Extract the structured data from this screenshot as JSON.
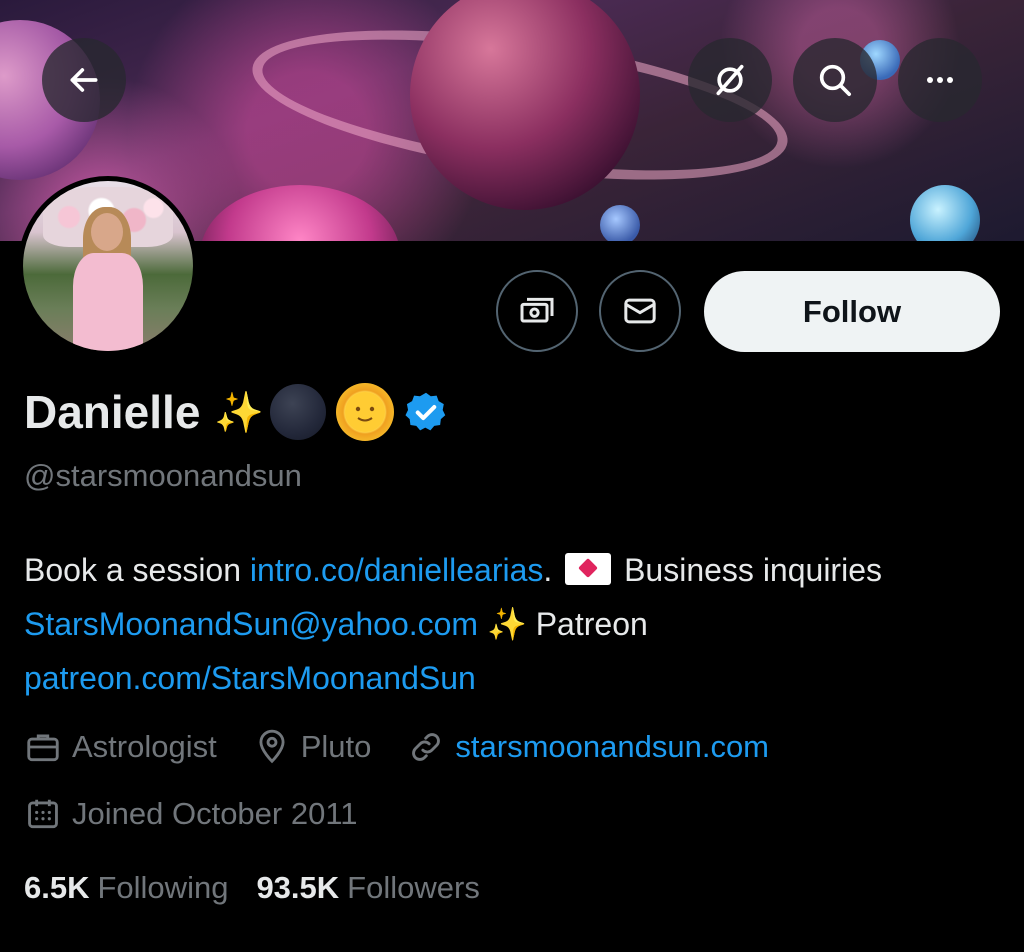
{
  "header": {
    "back_icon": "arrow-left-icon",
    "grok_icon": "grok-icon",
    "search_icon": "search-icon",
    "more_icon": "more-horizontal-icon"
  },
  "actions": {
    "subscribe_icon": "money-icon",
    "message_icon": "mail-icon",
    "follow_label": "Follow"
  },
  "profile": {
    "display_name": "Danielle",
    "name_emoji_sparkles": "✨",
    "handle": "@starsmoonandsun",
    "verified_color": "#1d9bf0"
  },
  "bio": {
    "t1": "Book a session ",
    "link1": "intro.co/daniellearias",
    "t2": ". ",
    "t3": " Business inquiries ",
    "link2": "StarsMoonandSun@yahoo.com",
    "t4": " ✨ Patreon ",
    "link3": "patreon.com/StarsMoonandSun"
  },
  "meta": {
    "profession": "Astrologist",
    "location": "Pluto",
    "website": "starsmoonandsun.com",
    "joined": "Joined October 2011"
  },
  "stats": {
    "following_count": "6.5K",
    "following_label": "Following",
    "followers_count": "93.5K",
    "followers_label": "Followers"
  },
  "colors": {
    "accent": "#1d9bf0",
    "secondary_text": "#71767b",
    "primary_text": "#e7e9ea",
    "background": "#000000"
  }
}
